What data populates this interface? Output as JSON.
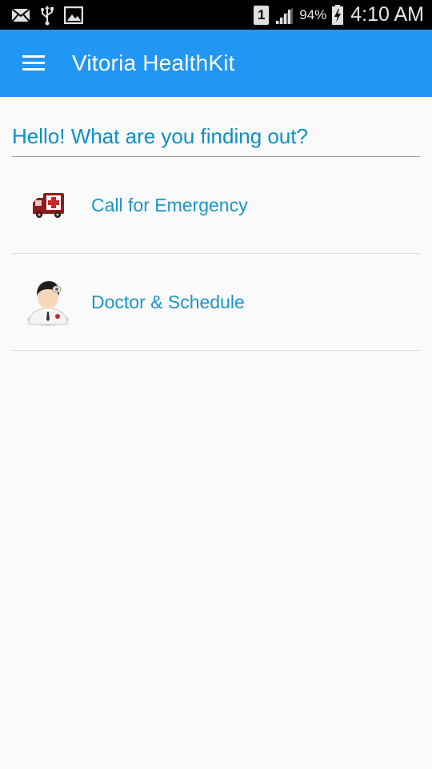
{
  "status_bar": {
    "left_icons": [
      "mail-icon",
      "usb-icon",
      "image-icon"
    ],
    "sim_slot": "1",
    "battery_percent": "94%",
    "time": "4:10 AM"
  },
  "app_bar": {
    "menu_icon": "hamburger-menu-icon",
    "title": "Vitoria HealthKit",
    "background_color": "#2196f3"
  },
  "main": {
    "greeting": "Hello! What are you finding out?",
    "items": [
      {
        "icon": "ambulance-icon",
        "label": "Call for Emergency"
      },
      {
        "icon": "doctor-icon",
        "label": "Doctor & Schedule"
      }
    ]
  },
  "colors": {
    "accent_text": "#0a8fc6",
    "status_bar": "#000000",
    "background": "#fafafa"
  }
}
